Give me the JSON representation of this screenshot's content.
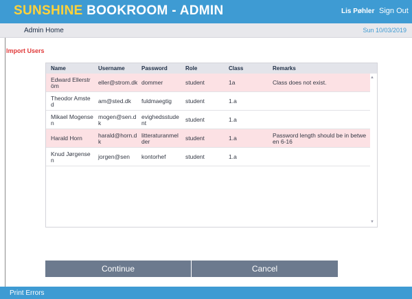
{
  "header": {
    "brand_accent": "SUNSHINE",
    "brand_rest": " BOOKROOM - ADMIN",
    "user": "Lis Pøhler",
    "signout": "Sign Out"
  },
  "subheader": {
    "home": "Admin Home",
    "date": "Sun 10/03/2019"
  },
  "section_title": "Import Users",
  "table": {
    "columns": [
      "Name",
      "Username",
      "Password",
      "Role",
      "Class",
      "Remarks"
    ],
    "rows": [
      {
        "error": true,
        "name": "Edward Ellerström",
        "username": "eller@strom.dk",
        "password": "dommer",
        "role": "student",
        "class": "1a",
        "remarks": "Class does not exist."
      },
      {
        "error": false,
        "name": "Theodor Amsted",
        "username": "am@sted.dk",
        "password": "fuldmaegtig",
        "role": "student",
        "class": "1.a",
        "remarks": ""
      },
      {
        "error": false,
        "name": "Mikael Mogensen",
        "username": "mogen@sen.dk",
        "password": "evighedsstudent",
        "role": "student",
        "class": "1.a",
        "remarks": ""
      },
      {
        "error": true,
        "name": "Harald Horn",
        "username": "harald@horn.dk",
        "password": "litteraturanmelder",
        "role": "student",
        "class": "1.a",
        "remarks": "Password length should be in between 6-16"
      },
      {
        "error": false,
        "name": "Knud Jørgensen",
        "username": "jorgen@sen",
        "password": "kontorhef",
        "role": "student",
        "class": "1.a",
        "remarks": ""
      }
    ]
  },
  "buttons": {
    "continue": "Continue",
    "cancel": "Cancel"
  },
  "footer": {
    "print_errors": "Print Errors"
  },
  "colors": {
    "header_bg": "#3e9bd3",
    "brand_accent": "#ffd23a",
    "error_row": "#fce1e4",
    "section_title": "#e03838",
    "button_bg": "#6c7a8e"
  }
}
